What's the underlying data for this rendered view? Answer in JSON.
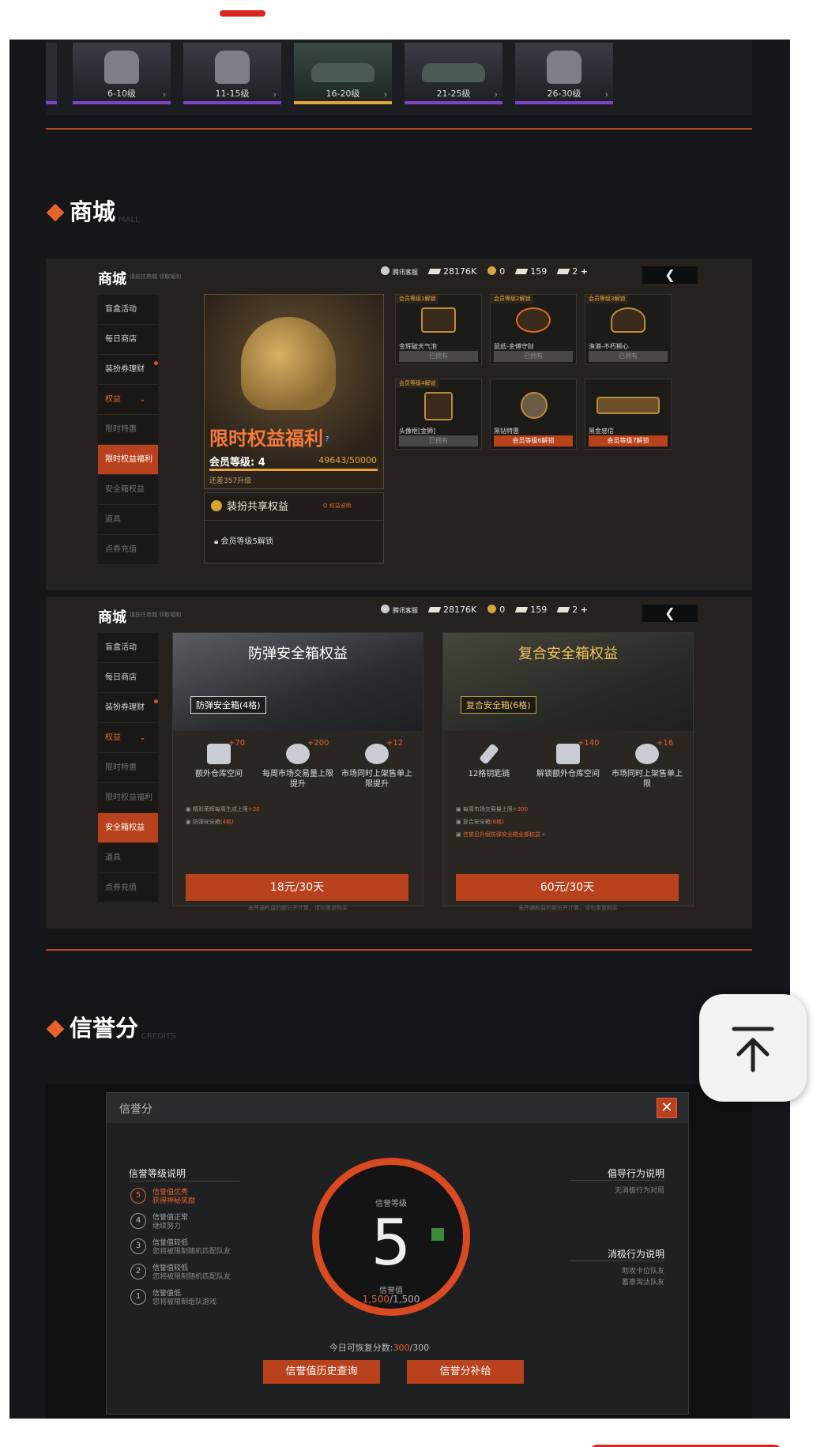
{
  "strip": {
    "levels": [
      "6-10级",
      "11-15级",
      "16-20级",
      "21-25级",
      "26-30级"
    ]
  },
  "sections": {
    "shop_title": "商城",
    "shop_en": "MALL",
    "credit_title": "信誉分",
    "credit_en": "CREDITS"
  },
  "panel_common": {
    "title": "商城",
    "subtitle": "请前往商城 领取福利",
    "service": "腾讯客服",
    "currency1": "28176K",
    "currency2": "0",
    "currency3": "159",
    "currency4": "2",
    "plus": "+",
    "back": "❮"
  },
  "nav1": [
    "盲盒活动",
    "每日商店",
    "装扮券理财",
    "权益",
    "限时特惠",
    "限时权益福利",
    "安全箱权益",
    "道具",
    "点券充值"
  ],
  "nav2": [
    "盲盒活动",
    "每日商店",
    "装扮券理财",
    "权益",
    "限时特惠",
    "限时权益福利",
    "安全箱权益",
    "道具",
    "点券充值"
  ],
  "perks": {
    "hero_title": "限时权益福利",
    "hero_q": "?",
    "member_level_label": "会员等级: 4",
    "member_progress": "49643/50000",
    "progress_fraction": 0.993,
    "upgrade_hint": "还差357升级",
    "share_title": "装扮共享权益",
    "share_link": "Q 权益说明",
    "share_lock": "会员等级5解锁",
    "cards": [
      {
        "tag": "会员等级1解锁",
        "name": "金辉破天气泡",
        "status": "已拥有"
      },
      {
        "tag": "会员等级2解锁",
        "name": "鼠纸-金傅守财",
        "status": "已拥有"
      },
      {
        "tag": "会员等级3解锁",
        "name": "渔港-不朽狮心",
        "status": "已拥有"
      },
      {
        "tag": "会员等级4解锁",
        "name": "头像框[金狮]",
        "status": "已拥有"
      },
      {
        "tag": "",
        "name": "黑钻特惠",
        "status": "会员等级6解锁"
      },
      {
        "tag": "",
        "name": "黑金感信",
        "status": "会员等级7解锁"
      }
    ]
  },
  "safebox": {
    "box1": {
      "title": "防弹安全箱权益",
      "tag": "防弹安全箱(4格)",
      "benefits": [
        {
          "bonus": "+70",
          "label": "额外仓库空间"
        },
        {
          "bonus": "+200",
          "label": "每周市场交易量上限提升"
        },
        {
          "bonus": "+12",
          "label": "市场同时上架售单上限提升"
        }
      ],
      "note1": "精彩荣辉每周生成上限",
      "note1_val": "+20",
      "note2": "防弹安全箱",
      "note2_val": "(4格)",
      "price": "18元/30天",
      "footer": "未开通权益的部分开计算，请勿重复购买"
    },
    "box2": {
      "title": "复合安全箱权益",
      "tag": "复合安全箱(6格)",
      "benefits": [
        {
          "bonus": "",
          "label": "12格钥匙链"
        },
        {
          "bonus": "+140",
          "label": "解锁额外仓库空间"
        },
        {
          "bonus": "+16",
          "label": "市场同时上架售单上限"
        }
      ],
      "note1": "每周市场交易量上限",
      "note1_val": "+300",
      "note2": "复合安全箱",
      "note2_val": "(6格)",
      "note3": "信誉且升级防弹安全箱全部权益",
      "price": "60元/30天",
      "footer": "未开通权益的部分开计算，请勿重复购买"
    }
  },
  "credit": {
    "dialog_title": "信誉分",
    "close": "✕",
    "levels_title": "信誉等级说明",
    "levels": [
      {
        "num": "5",
        "l1": "信誉值优秀",
        "l2": "获得神秘奖励"
      },
      {
        "num": "4",
        "l1": "信誉值正常",
        "l2": "继续努力"
      },
      {
        "num": "3",
        "l1": "信誉值较低",
        "l2": "您将被限制随机匹配队友"
      },
      {
        "num": "2",
        "l1": "信誉值较低",
        "l2": "您将被限制随机匹配队友"
      },
      {
        "num": "1",
        "l1": "信誉值低",
        "l2": "您将被限制组队游戏"
      }
    ],
    "grade_label": "信誉等级",
    "grade": "5",
    "value_label": "信誉值",
    "value_current": "1,500",
    "value_max": "/1,500",
    "positive_title": "倡导行为说明",
    "positive_sub": "无消极行为对局",
    "negative_title": "消极行为说明",
    "negative_sub1": "助攻卡位队友",
    "negative_sub2": "蓄意淘汰队友",
    "today_label": "今日可恢复分数:",
    "today_value": "300",
    "today_max": "/300",
    "btn_history": "信誉值历史查询",
    "btn_supplement": "信誉分补给"
  },
  "colors": {
    "accent": "#e4652c",
    "button": "#b8421d",
    "tab_indicator": "#d9251c"
  }
}
